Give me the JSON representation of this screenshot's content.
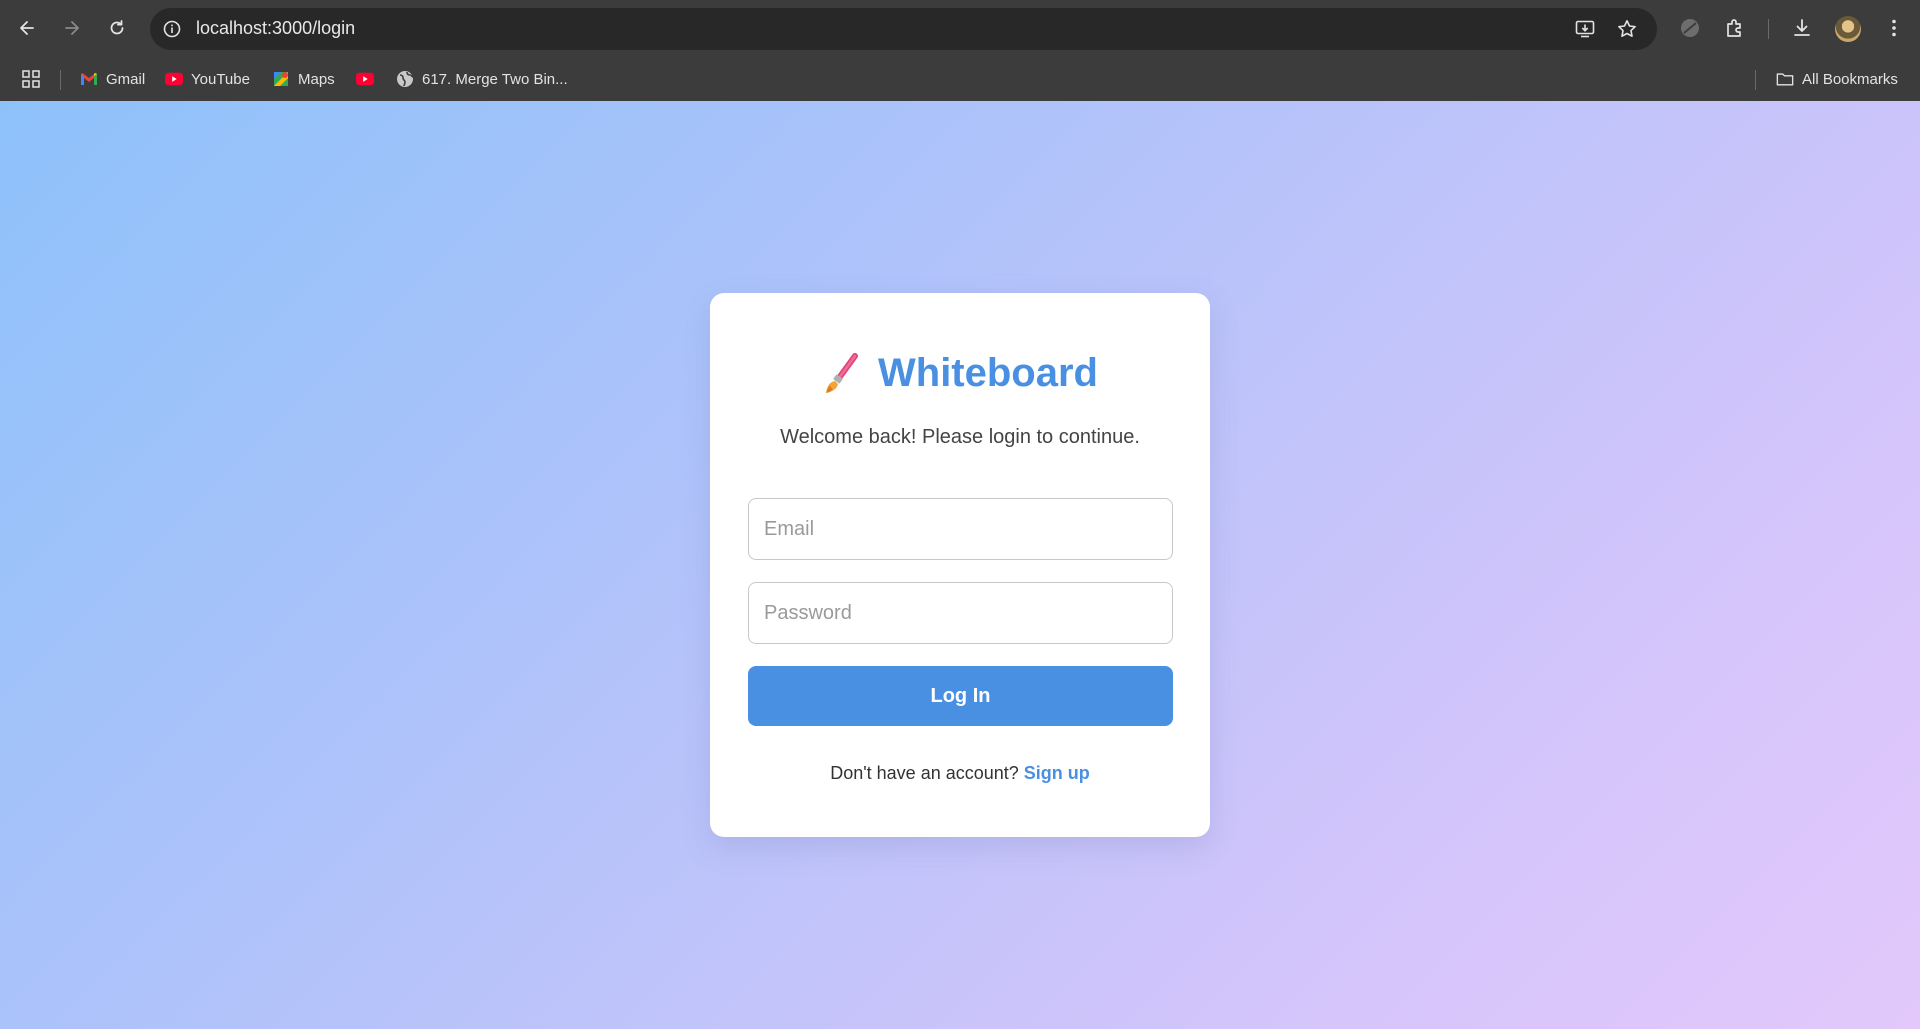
{
  "browser": {
    "url": "localhost:3000/login",
    "bookmarks": [
      {
        "label": "Gmail",
        "icon": "gmail-icon"
      },
      {
        "label": "YouTube",
        "icon": "youtube-icon"
      },
      {
        "label": "Maps",
        "icon": "maps-icon"
      },
      {
        "label": "",
        "icon": "youtube-icon"
      },
      {
        "label": "617. Merge Two Bin...",
        "icon": "globe-icon"
      }
    ],
    "all_bookmarks_label": "All Bookmarks"
  },
  "login": {
    "brand_title": "Whiteboard",
    "brand_icon": "paintbrush-icon",
    "subtitle": "Welcome back! Please login to continue.",
    "email_placeholder": "Email",
    "email_value": "",
    "password_placeholder": "Password",
    "password_value": "",
    "login_button_label": "Log In",
    "signup_prompt": "Don't have an account?",
    "signup_link_label": "Sign up"
  },
  "colors": {
    "accent": "#4a90e2",
    "chrome_bg": "#3c3c3c",
    "gradient_start": "#8ec1fa",
    "gradient_end": "#e2c8fb"
  }
}
